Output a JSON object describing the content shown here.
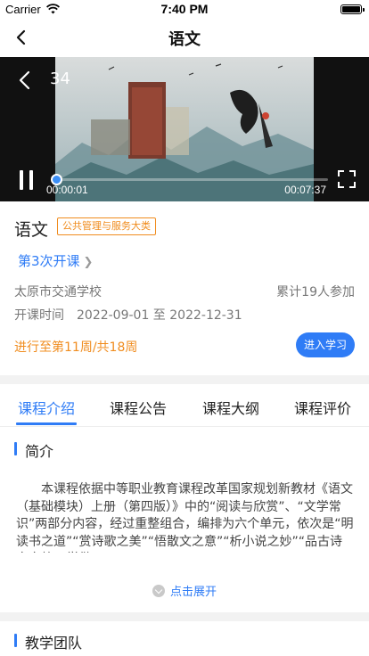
{
  "status_bar": {
    "carrier": "Carrier",
    "time": "7:40 PM"
  },
  "nav": {
    "title": "语文"
  },
  "video": {
    "index": "34",
    "current_time": "00:00:01",
    "total_time": "00:07:37",
    "progress_fraction": 0.003
  },
  "course": {
    "title": "语文",
    "category_badge": "公共管理与服务大类",
    "session": "第3次开课",
    "school": "太原市交通学校",
    "participants": "累计19人参加",
    "period_label": "开课时间",
    "period_dates": "2022-09-01 至 2022-12-31",
    "progress": "进行至第11周/共18周",
    "enter_button": "进入学习"
  },
  "tabs": [
    {
      "label": "课程介绍",
      "active": true
    },
    {
      "label": "课程公告",
      "active": false
    },
    {
      "label": "课程大纲",
      "active": false
    },
    {
      "label": "课程评价",
      "active": false
    }
  ],
  "intro": {
    "heading": "简介",
    "description": "本课程依据中等职业教育课程改革国家规划新教材《语文（基础模块）上册（第四版）》中的“阅读与欣赏”、“文学常识”两部分内容，经过重整组合，编排为六个单元，依次是“明读书之道”“赏诗歌之美”“悟散文之意”“析小说之妙”“品古诗文之韵”“学做...",
    "expand_label": "点击展开"
  },
  "team": {
    "heading": "教学团队"
  },
  "colors": {
    "accent": "#2f7cf6",
    "warning": "#f08c1e"
  }
}
